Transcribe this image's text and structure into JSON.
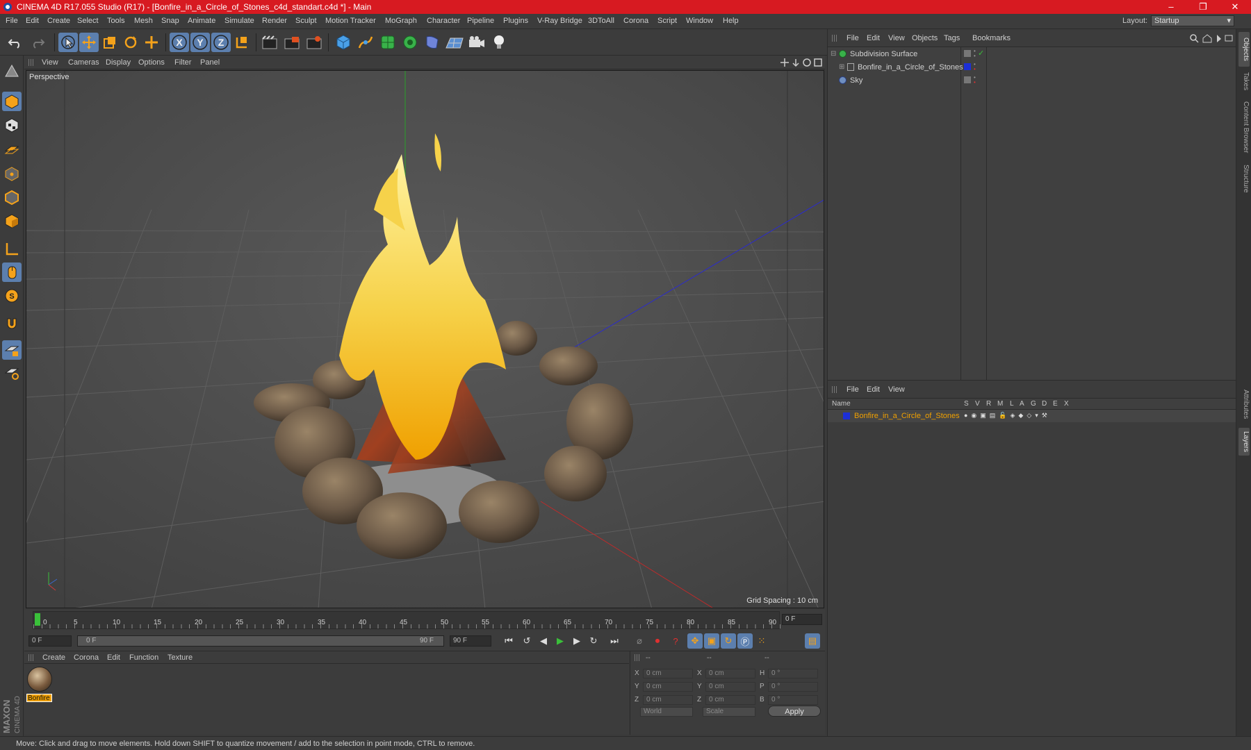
{
  "window": {
    "title": "CINEMA 4D R17.055 Studio (R17) - [Bonfire_in_a_Circle_of_Stones_c4d_standart.c4d *] - Main",
    "controls": [
      "–",
      "❐",
      "✕"
    ]
  },
  "menu": {
    "items": [
      "File",
      "Edit",
      "Create",
      "Select",
      "Tools",
      "Mesh",
      "Snap",
      "Animate",
      "Simulate",
      "Render",
      "Sculpt",
      "Motion Tracker",
      "MoGraph",
      "Character",
      "Pipeline",
      "Plugins",
      "V-Ray Bridge",
      "3DToAll",
      "Corona",
      "Script",
      "Window",
      "Help"
    ],
    "layout_label": "Layout:",
    "layout_value": "Startup"
  },
  "toolbar": {
    "axis_x": "X",
    "axis_y": "Y",
    "axis_z": "Z",
    "icons": [
      "undo-icon",
      "redo-icon",
      "select-arrow-icon",
      "move-icon",
      "scale-icon",
      "rotate-icon",
      "move-plus-icon",
      "x-axis-icon",
      "y-axis-icon",
      "z-axis-icon",
      "coordinate-system-icon",
      "render-view-icon",
      "render-picture-viewer-icon",
      "render-settings-icon",
      "cube-icon",
      "pen-spline-icon",
      "subdivision-icon",
      "array-icon",
      "deformer-icon",
      "floor-icon",
      "camera-icon",
      "light-icon"
    ]
  },
  "viewport": {
    "menu": [
      "View",
      "Cameras",
      "Display",
      "Options",
      "Filter",
      "Panel"
    ],
    "label": "Perspective",
    "grid_spacing": "Grid Spacing : 10 cm"
  },
  "timeline": {
    "ticks": [
      "0",
      "5",
      "10",
      "15",
      "20",
      "25",
      "30",
      "35",
      "40",
      "45",
      "50",
      "55",
      "60",
      "65",
      "70",
      "75",
      "80",
      "85",
      "90"
    ],
    "current_frame_display": "0 F"
  },
  "transport": {
    "start_field": "0 F",
    "range_start": "0 F",
    "range_end": "90 F",
    "end_field": "90 F"
  },
  "material_manager": {
    "menu": [
      "Create",
      "Corona",
      "Edit",
      "Function",
      "Texture"
    ],
    "materials": [
      {
        "name": "Bonfire"
      }
    ]
  },
  "coordinates": {
    "headers": [
      "--",
      "--",
      "--"
    ],
    "rows": [
      {
        "pos_label": "X",
        "pos": "0 cm",
        "size_label": "X",
        "size": "0 cm",
        "rot_label": "H",
        "rot": "0 °"
      },
      {
        "pos_label": "Y",
        "pos": "0 cm",
        "size_label": "Y",
        "size": "0 cm",
        "rot_label": "P",
        "rot": "0 °"
      },
      {
        "pos_label": "Z",
        "pos": "0 cm",
        "size_label": "Z",
        "size": "0 cm",
        "rot_label": "B",
        "rot": "0 °"
      }
    ],
    "mode_select": "World",
    "size_select": "Scale",
    "apply": "Apply"
  },
  "object_manager": {
    "menu": [
      "File",
      "Edit",
      "View",
      "Objects",
      "Tags",
      "Bookmarks"
    ],
    "objects": [
      {
        "name": "Subdivision Surface",
        "color": "#9a9a9a"
      },
      {
        "name": "Bonfire_in_a_Circle_of_Stones",
        "color": "#1c2fd6"
      },
      {
        "name": "Sky",
        "color": "#9a9a9a"
      }
    ]
  },
  "layer_manager": {
    "menu": [
      "File",
      "Edit",
      "View"
    ],
    "columns": [
      "Name",
      "S",
      "V",
      "R",
      "M",
      "L",
      "A",
      "G",
      "D",
      "E",
      "X"
    ],
    "layers": [
      {
        "name": "Bonfire_in_a_Circle_of_Stones",
        "color": "#1c2fd6"
      }
    ]
  },
  "right_tabs": [
    "Objects",
    "Takes",
    "Content Browser",
    "Structure",
    "Attributes",
    "Layers"
  ],
  "status": "Move: Click and drag to move elements. Hold down SHIFT to quantize movement / add to the selection in point mode, CTRL to remove.",
  "brand": {
    "line1": "MAXON",
    "line2": "CINEMA 4D"
  },
  "colors": {
    "titlebar": "#d71a21",
    "selection": "#5c7fae",
    "accent_orange": "#f0a000"
  }
}
